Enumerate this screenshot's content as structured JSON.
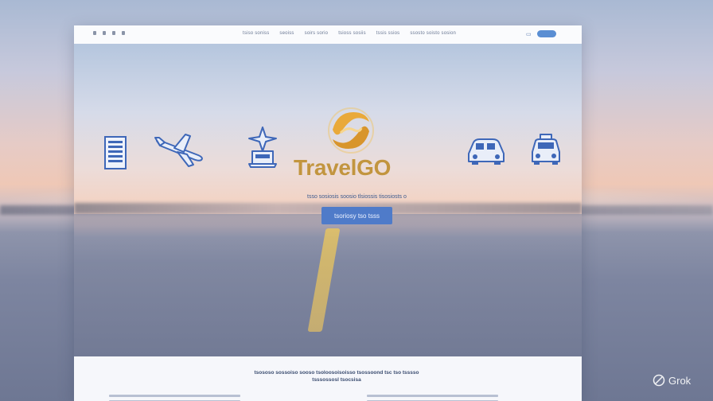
{
  "nav": {
    "items": [
      "tsiso soniss",
      "seoiss",
      "soirs sorio",
      "tsioss sosiis",
      "tssis ssios",
      "ssosto soisto sosion"
    ]
  },
  "hero": {
    "brand": "TravelGO",
    "tagline": "tsso sosiosis soosio tlsiossis tisosiosts o",
    "cta_label": "tsoriosy tso tsss",
    "brand_color": "#c2953f",
    "accent_color": "#4f7bc9",
    "icons": [
      "hotel-icon",
      "airplane-icon",
      "airport-tower-icon",
      "car-icon",
      "taxi-icon"
    ]
  },
  "content": {
    "title": "tsososo sossoiso sooso tsoloosoisoisso tsossoond tsc tso tsssso tsssossosl tsocsisa"
  },
  "watermark": {
    "label": "Grok"
  }
}
